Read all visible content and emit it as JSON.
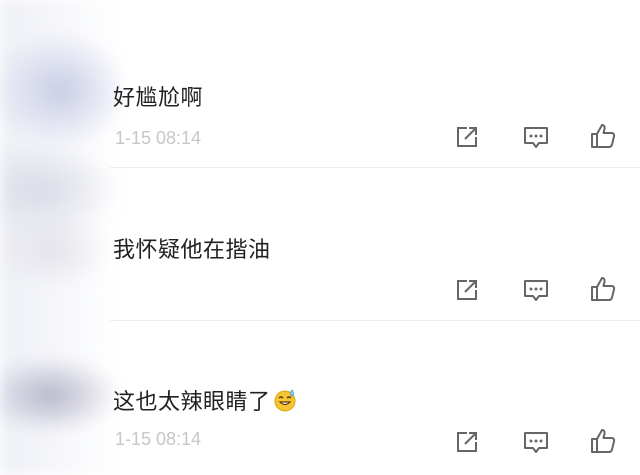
{
  "comments": [
    {
      "text": "好尴尬啊",
      "time": "1-15 08:14"
    },
    {
      "text": "我怀疑他在揩油",
      "time": ""
    },
    {
      "text": "这也太辣眼睛了",
      "emoji": "grinning-sweat-emoji",
      "time": "1-15 08:14"
    }
  ],
  "actions": {
    "share_icon": "share-icon",
    "reply_icon": "comment-icon",
    "like_icon": "thumbs-up-icon"
  },
  "colors": {
    "text": "#222222",
    "time": "#c7c7c7",
    "icon": "#666666",
    "divider": "#ececec"
  }
}
